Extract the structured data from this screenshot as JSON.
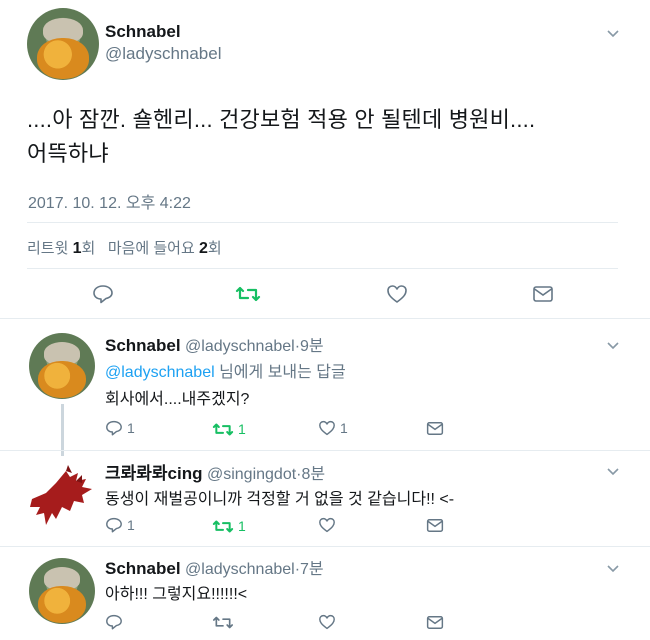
{
  "main_tweet": {
    "author_name": "Schnabel",
    "author_handle": "@ladyschnabel",
    "text_line1": "....아 잠깐. 숄헨리... 건강보험 적용 안 될텐데 병원비....",
    "text_line2": "어뜩하냐",
    "timestamp": "2017. 10. 12. 오후 4:22",
    "retweet_label": "리트윗",
    "retweet_count": "1",
    "count_suffix": "회",
    "like_label": "마음에 들어요",
    "like_count": "2",
    "colors": {
      "retweeted": "#17bf63",
      "link": "#1da1f2",
      "muted": "#657786"
    }
  },
  "replies": [
    {
      "author_name": "Schnabel",
      "author_handle": "@ladyschnabel",
      "time": "·9분",
      "reply_to_handle": "@ladyschnabel",
      "reply_to_suffix": " 님에게 보내는 답글",
      "text": "회사에서....내주겠지?",
      "reply_count": "1",
      "retweet_count": "1",
      "like_count": "1"
    },
    {
      "author_name": "크롸롸롸cing",
      "author_handle": "@singingdot",
      "time": "·8분",
      "text": "동생이 재벌공이니까 걱정할 거 없을 것 같습니다!! <-",
      "reply_count": "1",
      "retweet_count": "1",
      "like_count": ""
    },
    {
      "author_name": "Schnabel",
      "author_handle": "@ladyschnabel",
      "time": "·7분",
      "text": "아하!!! 그렇지요!!!!!!<",
      "reply_count": "",
      "retweet_count": "",
      "like_count": ""
    }
  ],
  "icons": [
    "reply-icon",
    "retweet-icon",
    "like-icon",
    "dm-icon",
    "chevron-down-icon"
  ]
}
